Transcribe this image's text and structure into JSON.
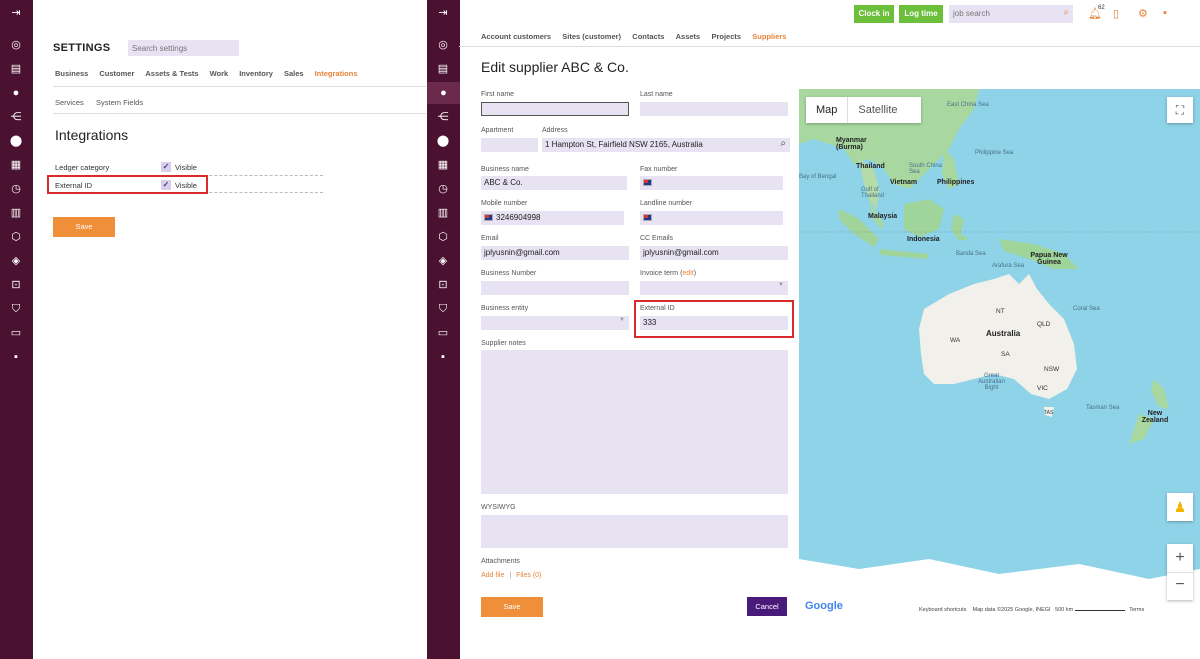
{
  "left": {
    "settings_title": "SETTINGS",
    "search_placeholder": "Search settings",
    "tabs": [
      "Business",
      "Customer",
      "Assets & Tests",
      "Work",
      "Inventory",
      "Sales",
      "Integrations"
    ],
    "active_tab": "Integrations",
    "subtabs": [
      "Services",
      "System Fields"
    ],
    "active_subtab": "System Fields",
    "section_title": "Integrations",
    "rows": [
      {
        "label": "Ledger category",
        "check_label": "Visible",
        "checked": true
      },
      {
        "label": "External ID",
        "check_label": "Visible",
        "checked": true
      }
    ],
    "save_label": "Save"
  },
  "top": {
    "clock_in": "Clock in",
    "log_time": "Log time",
    "job_search_placeholder": "job search",
    "notif_count": "62"
  },
  "right": {
    "tabs": [
      "Account customers",
      "Sites (customer)",
      "Contacts",
      "Assets",
      "Projects",
      "Suppliers"
    ],
    "active_tab": "Suppliers",
    "title": "Edit supplier ABC & Co.",
    "fields": {
      "first_name": {
        "label": "First name",
        "value": ""
      },
      "last_name": {
        "label": "Last name",
        "value": ""
      },
      "apartment": {
        "label": "Apartment",
        "value": ""
      },
      "address": {
        "label": "Address",
        "value": "1 Hampton St, Fairfield NSW 2165, Australia"
      },
      "business_name": {
        "label": "Business name",
        "value": "ABC & Co."
      },
      "fax": {
        "label": "Fax number",
        "value": ""
      },
      "mobile": {
        "label": "Mobile number",
        "value": "3246904998"
      },
      "landline": {
        "label": "Landline number",
        "value": ""
      },
      "email": {
        "label": "Email",
        "value": "jplyusnin@gmail.com"
      },
      "cc_emails": {
        "label": "CC Emails",
        "value": "jplyusnin@gmail.com"
      },
      "business_number": {
        "label": "Business Number",
        "value": ""
      },
      "invoice_term": {
        "label": "Invoice term",
        "edit": "edit",
        "value": ""
      },
      "business_entity": {
        "label": "Business entity",
        "value": ""
      },
      "external_id": {
        "label": "External ID",
        "value": "333"
      },
      "supplier_notes": {
        "label": "Supplier notes"
      },
      "wysiwyg": {
        "label": "WYSIWYG"
      },
      "attachments": {
        "label": "Attachments",
        "add_file": "Add file",
        "sep": "|",
        "files": "Files (0)"
      }
    },
    "save_label": "Save",
    "cancel_label": "Cancel"
  },
  "map": {
    "tab_map": "Map",
    "tab_satellite": "Satellite",
    "labels": {
      "east_china_sea": "East China Sea",
      "myanmar": "Myanmar (Burma)",
      "thailand": "Thailand",
      "south_china_sea": "South China Sea",
      "philippine_sea": "Philippine Sea",
      "bay_of_bengal": "Bay of Bengal",
      "vietnam": "Vietnam",
      "philippines": "Philippines",
      "gulf_of_thailand": "Gulf of Thailand",
      "malaysia": "Malaysia",
      "indonesia": "Indonesia",
      "banda_sea": "Banda Sea",
      "arafura_sea": "Arafura Sea",
      "papua_new_guinea": "Papua New Guinea",
      "coral_sea": "Coral Sea",
      "nt": "NT",
      "qld": "QLD",
      "australia": "Australia",
      "wa": "WA",
      "sa": "SA",
      "nsw": "NSW",
      "vic": "VIC",
      "great_australian_bight": "Great Australian Bight",
      "tas": "TAS",
      "tasman_sea": "Tasman Sea",
      "new_zealand": "New Zealand"
    },
    "google": "Google",
    "keyboard": "Keyboard shortcuts",
    "map_data": "Map data ©2025 Google, INEGI",
    "scale": "500 km",
    "terms": "Terms"
  },
  "colors": {
    "sidebar": "#4a1230",
    "accent": "#e8833a",
    "highlight": "#d92b2b",
    "input_bg": "#e8e3f3",
    "button_green": "#6bbf3a",
    "cancel": "#4a1a7a"
  }
}
